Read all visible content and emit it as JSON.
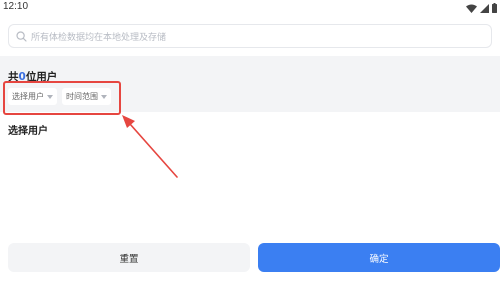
{
  "status_bar": {
    "time": "12:10",
    "icons": [
      "wifi-icon",
      "signal-icon",
      "battery-icon"
    ]
  },
  "search": {
    "placeholder": "所有体检数据均在本地处理及存储",
    "icon": "search-icon"
  },
  "summary": {
    "prefix": "共",
    "count": "0",
    "suffix": "位用户"
  },
  "filters": [
    {
      "label": "选择用户",
      "icon": "chevron-down-icon"
    },
    {
      "label": "时间范围",
      "icon": "chevron-down-icon"
    }
  ],
  "section": {
    "title": "选择用户"
  },
  "footer": {
    "reset_label": "重置",
    "confirm_label": "确定"
  },
  "colors": {
    "accent": "#3b7ff2",
    "count_highlight": "#3b6fe0",
    "annotation_red": "#e64640",
    "band_bg": "#f3f4f6"
  }
}
